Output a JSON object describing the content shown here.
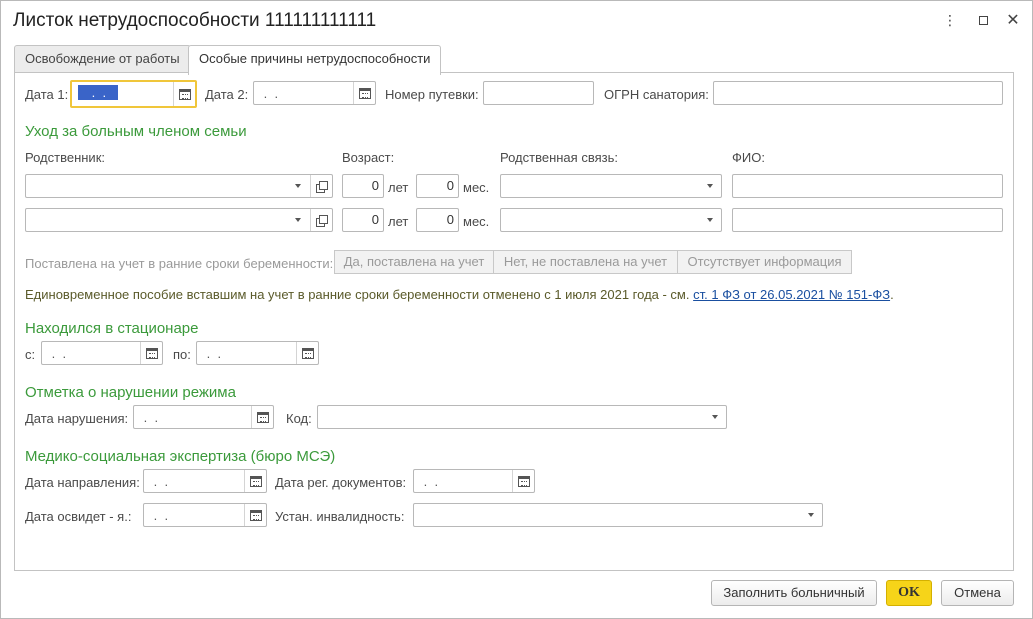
{
  "window": {
    "title": "Листок нетрудоспособности 111111111111"
  },
  "tabs": [
    {
      "label": "Освобождение от работы"
    },
    {
      "label": "Особые причины нетрудоспособности"
    }
  ],
  "top_row": {
    "date1_label": "Дата 1:",
    "date1_value": " .  . ",
    "date2_label": "Дата 2:",
    "date2_value": " .  . ",
    "voucher_label": "Номер путевки:",
    "voucher_value": "",
    "ogrn_label": "ОГРН санатория:",
    "ogrn_value": ""
  },
  "family_care": {
    "title": "Уход за больным членом семьи",
    "col_relative": "Родственник:",
    "col_age": "Возраст:",
    "col_relation": "Родственная связь:",
    "col_fio": "ФИО:",
    "years_unit": "лет",
    "months_unit": "мес.",
    "rows": [
      {
        "relative": "",
        "years": "0",
        "months": "0",
        "relation": "",
        "fio": ""
      },
      {
        "relative": "",
        "years": "0",
        "months": "0",
        "relation": "",
        "fio": ""
      }
    ]
  },
  "pregnancy": {
    "label": "Поставлена на учет в ранние сроки беременности:",
    "options": [
      "Да, поставлена на учет",
      "Нет, не поставлена на учет",
      "Отсутствует информация"
    ],
    "note": "Единовременное пособие вставшим на учет в ранние сроки беременности отменено с 1 июля 2021 года - см.",
    "note_link": "ст. 1 ФЗ от 26.05.2021 № 151-ФЗ",
    "note_end": "."
  },
  "hospital": {
    "title": "Находился в стационаре",
    "from_label": "с:",
    "from_value": " .  . ",
    "to_label": "по:",
    "to_value": " .  . "
  },
  "violation": {
    "title": "Отметка о нарушении режима",
    "date_label": "Дата нарушения:",
    "date_value": " .  . ",
    "code_label": "Код:",
    "code_value": ""
  },
  "mse": {
    "title": "Медико-социальная экспертиза (бюро МСЭ)",
    "referral_label": "Дата направления:",
    "referral_value": " .  . ",
    "docs_label": "Дата рег. документов:",
    "docs_value": " .  . ",
    "exam_label": "Дата освидет - я.:",
    "exam_value": " .  . ",
    "disability_label": "Устан. инвалидность:",
    "disability_value": ""
  },
  "footer": {
    "fill_label": "Заполнить больничный",
    "ok_label": "OK",
    "cancel_label": "Отмена"
  }
}
